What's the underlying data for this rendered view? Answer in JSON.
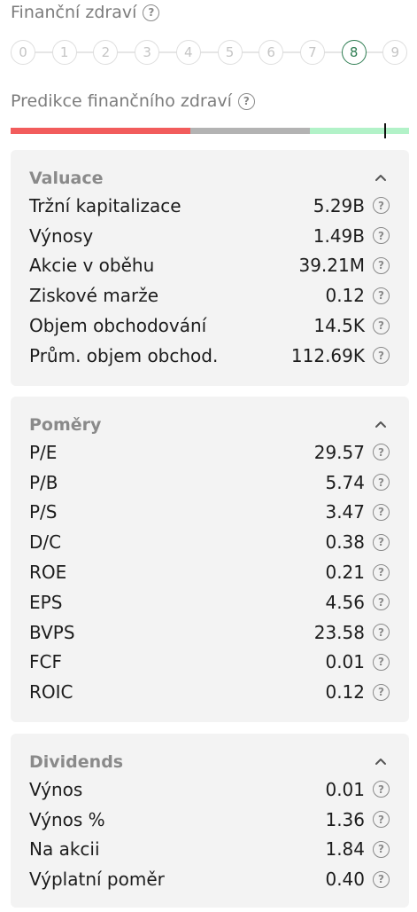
{
  "financial_health": {
    "title": "Finanční zdraví",
    "scale": [
      "0",
      "1",
      "2",
      "3",
      "4",
      "5",
      "6",
      "7",
      "8",
      "9"
    ],
    "selected": "8",
    "active_color": "#2e7d52"
  },
  "prediction": {
    "title": "Predikce finančního zdraví",
    "segments_colors": [
      "#f25c5c",
      "#b3b3b3",
      "#b2f2c8"
    ],
    "marker_position": 0.94
  },
  "help_icon": "?",
  "valuation": {
    "title": "Valuace",
    "rows": [
      {
        "label": "Tržní kapitalizace",
        "value": "5.29B"
      },
      {
        "label": "Výnosy",
        "value": "1.49B"
      },
      {
        "label": "Akcie v oběhu",
        "value": "39.21M"
      },
      {
        "label": "Ziskové marže",
        "value": "0.12"
      },
      {
        "label": "Objem obchodování",
        "value": "14.5K"
      },
      {
        "label": "Prům. objem obchod.",
        "value": "112.69K"
      }
    ]
  },
  "ratios": {
    "title": "Poměry",
    "rows": [
      {
        "label": "P/E",
        "value": "29.57"
      },
      {
        "label": "P/B",
        "value": "5.74"
      },
      {
        "label": "P/S",
        "value": "3.47"
      },
      {
        "label": "D/C",
        "value": "0.38"
      },
      {
        "label": "ROE",
        "value": "0.21"
      },
      {
        "label": "EPS",
        "value": "4.56"
      },
      {
        "label": "BVPS",
        "value": "23.58"
      },
      {
        "label": "FCF",
        "value": "0.01"
      },
      {
        "label": "ROIC",
        "value": "0.12"
      }
    ]
  },
  "dividends": {
    "title": "Dividends",
    "rows": [
      {
        "label": "Výnos",
        "value": "0.01"
      },
      {
        "label": "Výnos %",
        "value": "1.36"
      },
      {
        "label": "Na akcii",
        "value": "1.84"
      },
      {
        "label": "Výplatní poměr",
        "value": "0.40"
      }
    ]
  }
}
